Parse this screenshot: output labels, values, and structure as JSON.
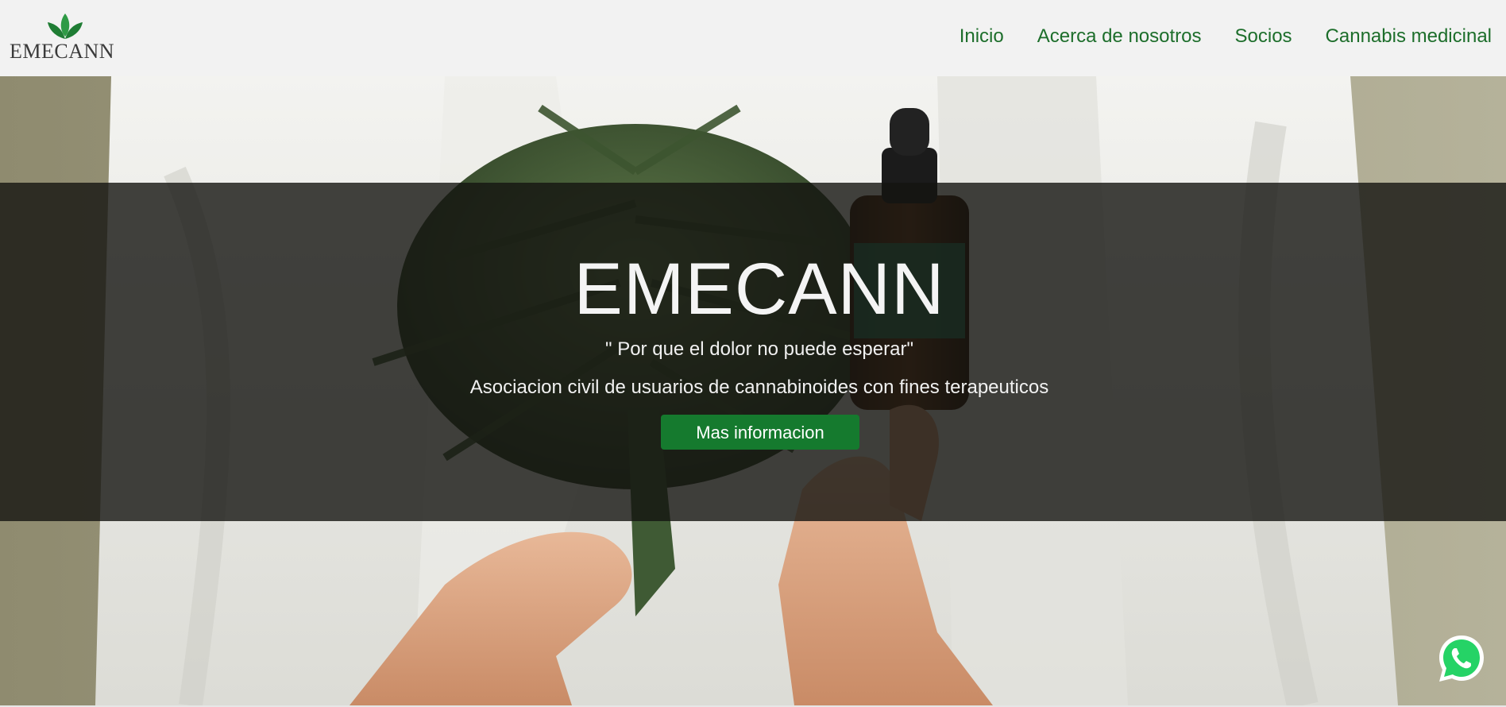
{
  "brand": {
    "logo_text": "EMECANN",
    "logo_icon": "cannabis-leaves-icon",
    "color": "#1d6e2b"
  },
  "nav": {
    "items": [
      {
        "label": "Inicio"
      },
      {
        "label": "Acerca de nosotros"
      },
      {
        "label": "Socios"
      },
      {
        "label": "Cannabis medicinal"
      }
    ]
  },
  "hero": {
    "title": "EMECANN",
    "quote": "\" Por que el dolor no puede esperar\"",
    "description": "Asociacion civil de usuarios de cannabinoides con fines terapeuticos",
    "button_label": "Mas informacion",
    "button_color": "#157a2e"
  },
  "floating": {
    "whatsapp_icon": "whatsapp-icon",
    "whatsapp_color": "#25d366"
  }
}
